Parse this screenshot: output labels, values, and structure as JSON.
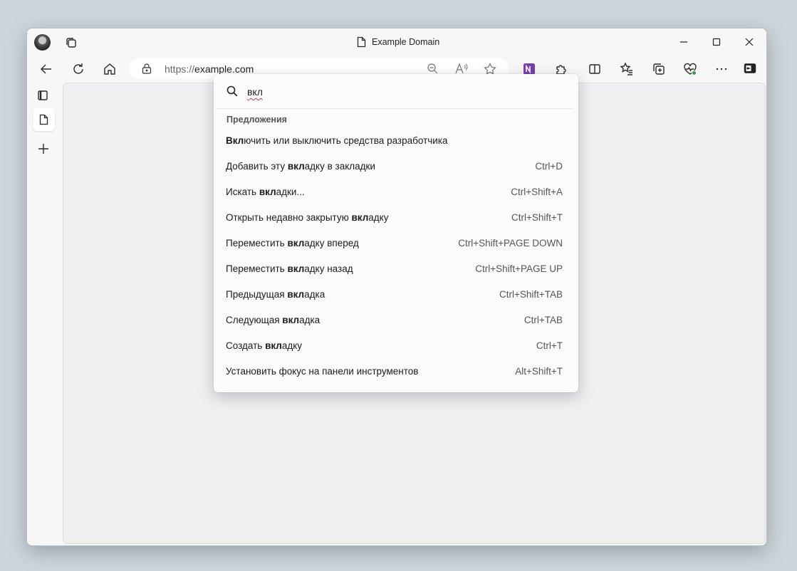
{
  "window": {
    "title": "Example Domain"
  },
  "address_bar": {
    "url_protocol": "https://",
    "url_host": "example.com"
  },
  "command_palette": {
    "query": "вкл",
    "section_label": "Предложения",
    "items": [
      {
        "pre": "",
        "match": "Вкл",
        "post": "ючить или выключить средства разработчика",
        "shortcut": ""
      },
      {
        "pre": "Добавить эту ",
        "match": "вкл",
        "post": "адку в закладки",
        "shortcut": "Ctrl+D"
      },
      {
        "pre": "Искать ",
        "match": "вкл",
        "post": "адки...",
        "shortcut": "Ctrl+Shift+A"
      },
      {
        "pre": "Открыть недавно закрытую ",
        "match": "вкл",
        "post": "адку",
        "shortcut": "Ctrl+Shift+T"
      },
      {
        "pre": "Переместить ",
        "match": "вкл",
        "post": "адку вперед",
        "shortcut": "Ctrl+Shift+PAGE DOWN"
      },
      {
        "pre": "Переместить ",
        "match": "вкл",
        "post": "адку назад",
        "shortcut": "Ctrl+Shift+PAGE UP"
      },
      {
        "pre": "Предыдущая ",
        "match": "вкл",
        "post": "адка",
        "shortcut": "Ctrl+Shift+TAB"
      },
      {
        "pre": "Следующая ",
        "match": "вкл",
        "post": "адка",
        "shortcut": "Ctrl+TAB"
      },
      {
        "pre": "Создать ",
        "match": "вкл",
        "post": "адку",
        "shortcut": "Ctrl+T"
      },
      {
        "pre": "Установить фокус на панели инструментов",
        "match": "",
        "post": "",
        "shortcut": "Alt+Shift+T"
      }
    ]
  }
}
